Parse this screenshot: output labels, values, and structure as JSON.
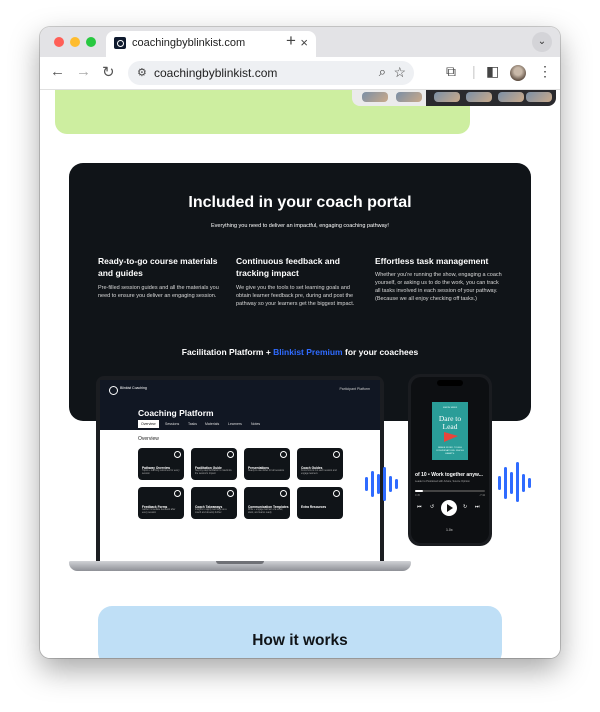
{
  "browser": {
    "tab_title": "coachingbyblinkist.com",
    "tab_close": "×",
    "new_tab": "+",
    "tab_menu": "⌄",
    "url": "coachingbyblinkist.com",
    "back": "←",
    "forward": "→",
    "reload": "↻",
    "zoom_icon": "⌕",
    "star_icon": "☆",
    "menu_icon": "⋮"
  },
  "portal": {
    "title": "Included in your coach portal",
    "subtitle": "Everything you need to deliver an impactful, engaging coaching pathway!",
    "features": [
      {
        "title": "Ready-to-go course materials and guides",
        "body": "Pre-filled session guides and all the materials you need to ensure you deliver an engaging session."
      },
      {
        "title": "Continuous feedback and tracking impact",
        "body": "We give you the tools to set learning goals and obtain learner feedback pre, during and post the pathway so your learners get the biggest impact."
      },
      {
        "title": "Effortless task management",
        "body": "Whether you're running the show, engaging a coach yourself, or asking us to do the work, you can track all tasks involved in each session of your pathway. (Because we all enjoy checking off tasks.)"
      }
    ],
    "facilitation_prefix": "Facilitation Platform +",
    "facilitation_highlight": "Blinkist Premium",
    "facilitation_suffix": "for your coachees"
  },
  "laptop": {
    "logo_text": "Blinkist Coaching",
    "user": "Participant Platform",
    "title": "Coaching Platform",
    "tabs": [
      "Overview",
      "Sessions",
      "Tasks",
      "Materials",
      "Learners",
      "Notes"
    ],
    "section": "Overview",
    "cards": [
      {
        "title": "Pathway Overview",
        "body": "Topics + learning outcomes for every session"
      },
      {
        "title": "Facilitation Guide",
        "body": "Step-by-step facilitation to maximize the session's impact"
      },
      {
        "title": "Presentations",
        "body": "Ready-to-use slides for all sessions"
      },
      {
        "title": "Coach Guides",
        "body": "Know how to run each session and engage learners"
      },
      {
        "title": "Feedback Forms",
        "body": "Gather immediate feedback after every session"
      },
      {
        "title": "Coach Takeaways",
        "body": "Insights to apply learnings as a coach and develop further"
      },
      {
        "title": "Communication Templates",
        "body": "Write + engage learners via email, slack, and teams ready"
      },
      {
        "title": "Extra Resources",
        "body": ""
      }
    ]
  },
  "phone": {
    "book_author": "SIMON SINEK",
    "book_title": "Dare to Lead",
    "book_subtitle": "BRAVE WORK. TOUGH CONVERSATIONS. WHOLE HEARTS.",
    "track_title": "of 10 • Work together anyw...",
    "track_sub": "Leader to Positioned with Advice, Source Opinion",
    "time_elapsed": "0:45",
    "time_left": "-7:42",
    "progress": 0.12,
    "speed": "1.0x",
    "btn_prev": "⏮",
    "btn_back": "↺",
    "btn_forward": "↻",
    "btn_next": "⏭"
  },
  "how": {
    "title": "How it works"
  },
  "colors": {
    "accent_blue": "#2f6bff",
    "dark_bg": "#101418",
    "green_band": "#cdeea0",
    "how_bg": "#bfdff6"
  }
}
